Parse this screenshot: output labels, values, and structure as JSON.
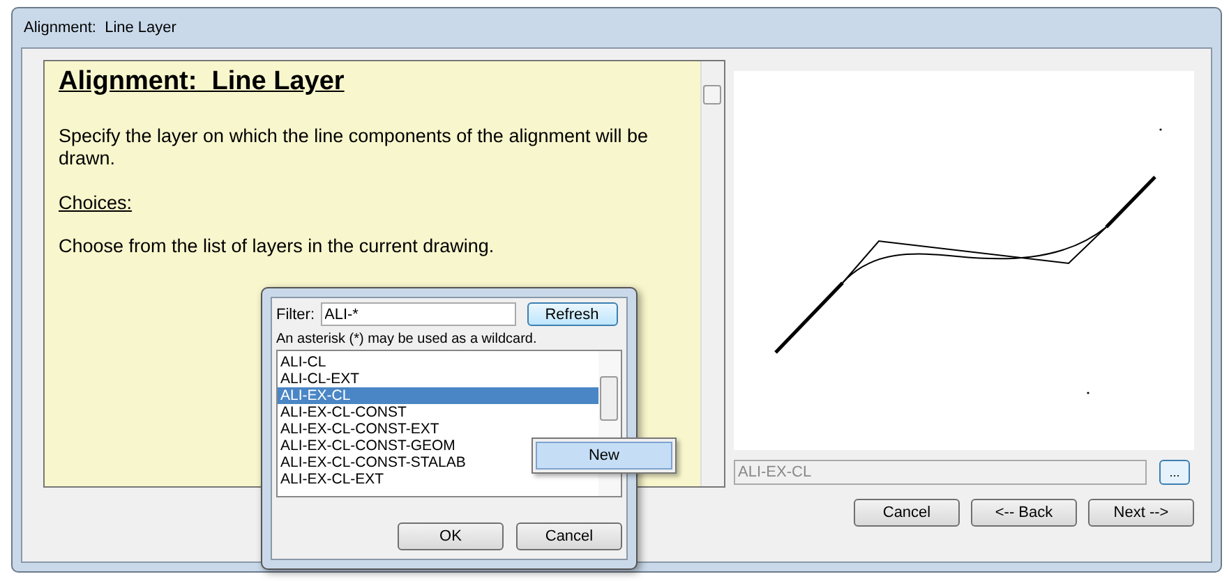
{
  "window": {
    "title": "Alignment:  Line Layer"
  },
  "help": {
    "heading": "Alignment:  Line Layer",
    "paragraphs": [
      {
        "kind": "text",
        "text": "Specify the layer on which the line components of the alignment will be drawn."
      },
      {
        "kind": "subheading",
        "text": "Choices:"
      },
      {
        "kind": "text",
        "text": "Choose from the list of layers in the current drawing."
      }
    ]
  },
  "layer_field": {
    "value": "ALI-EX-CL",
    "disabled": true,
    "browse_label": "..."
  },
  "buttons": [
    "Cancel",
    "<-- Back",
    "Next -->"
  ],
  "popup": {
    "filter_label": "Filter:",
    "filter_value": "ALI-*",
    "refresh_label": "Refresh",
    "hint": "An asterisk (*) may be used as a wildcard.",
    "layers": [
      {
        "name": "ALI-CL",
        "selected": false
      },
      {
        "name": "ALI-CL-EXT",
        "selected": false
      },
      {
        "name": "ALI-EX-CL",
        "selected": true
      },
      {
        "name": "ALI-EX-CL-CONST",
        "selected": false
      },
      {
        "name": "ALI-EX-CL-CONST-EXT",
        "selected": false
      },
      {
        "name": "ALI-EX-CL-CONST-GEOM",
        "selected": false
      },
      {
        "name": "ALI-EX-CL-CONST-STALAB",
        "selected": false
      },
      {
        "name": "ALI-EX-CL-EXT",
        "selected": false
      }
    ],
    "buttons": [
      "OK",
      "Cancel"
    ]
  },
  "context_menu": {
    "items": [
      {
        "label": "New",
        "selected": true
      }
    ]
  }
}
